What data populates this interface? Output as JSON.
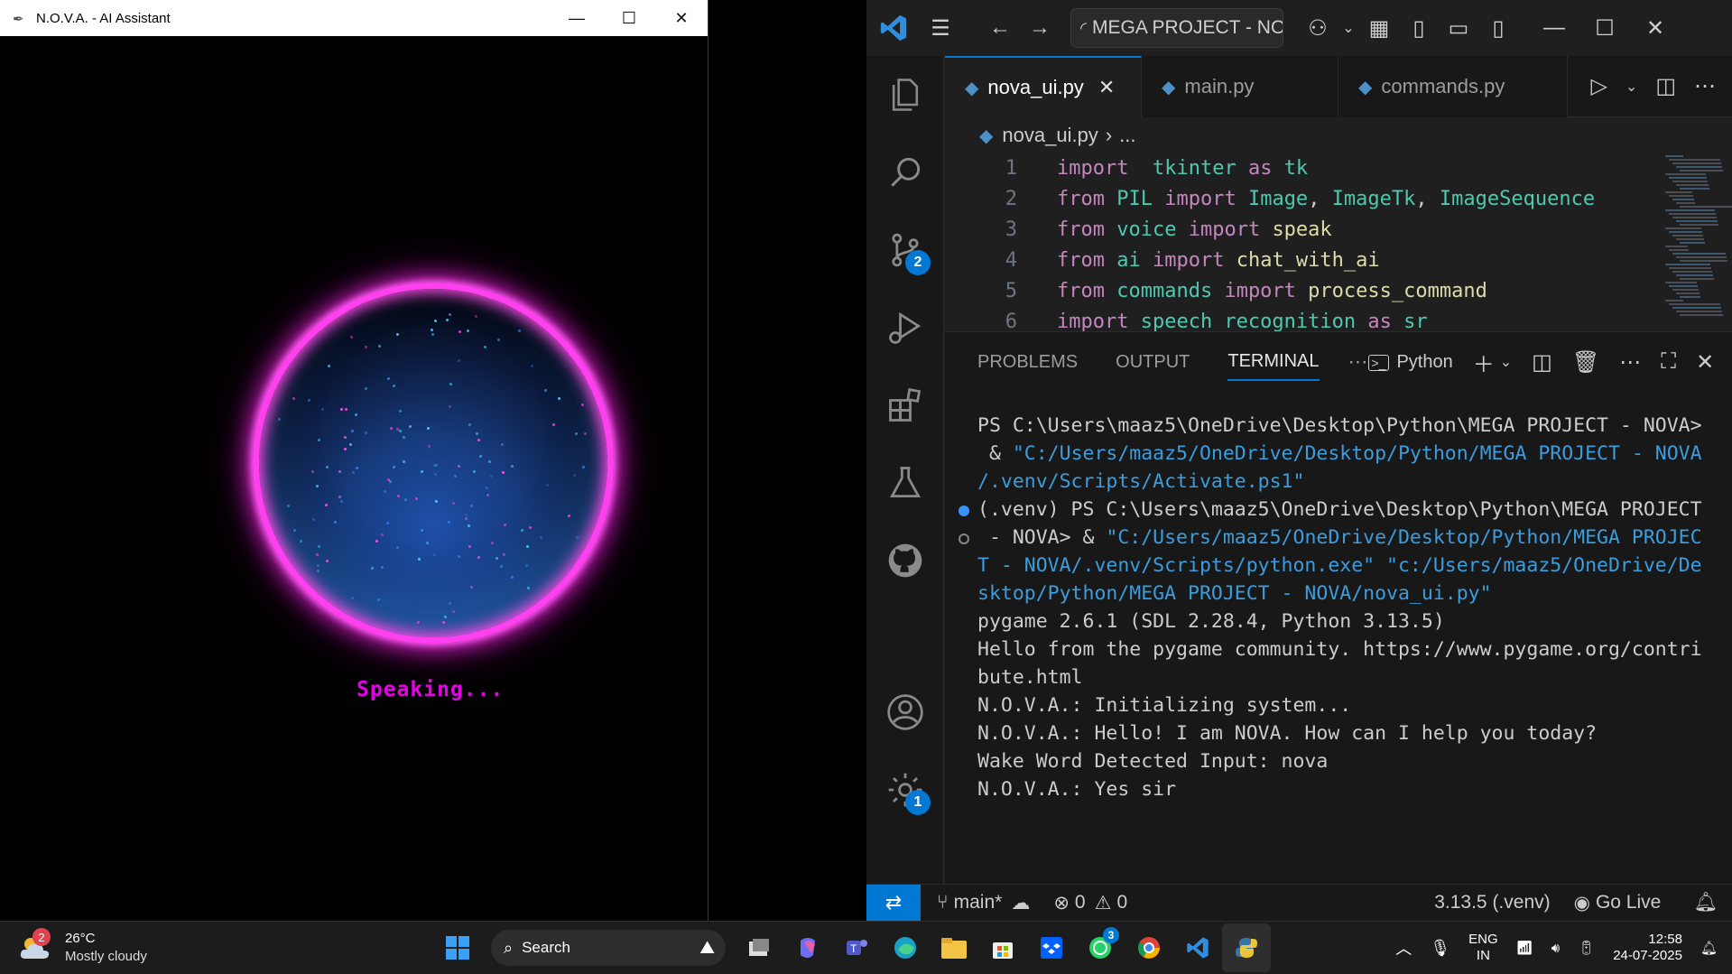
{
  "nova_window": {
    "title": "N.O.V.A. - AI Assistant",
    "status_text": "Speaking...",
    "colors": {
      "ring": "#ff40ef",
      "status": "#e600e6",
      "core": "#1e4fa8"
    }
  },
  "vscode": {
    "command_center": "MEGA PROJECT - NOVA",
    "tabs": [
      {
        "label": "nova_ui.py",
        "active": true
      },
      {
        "label": "main.py",
        "active": false
      },
      {
        "label": "commands.py",
        "active": false
      }
    ],
    "breadcrumb": {
      "file": "nova_ui.py",
      "rest": "..."
    },
    "code_lines": [
      {
        "n": "1",
        "t": [
          [
            "kw",
            "import"
          ],
          [
            "",
            "  "
          ],
          [
            "md",
            "tkinter"
          ],
          [
            "",
            ""
          ],
          [
            "kw",
            " as "
          ],
          [
            "md",
            "tk"
          ]
        ]
      },
      {
        "n": "2",
        "t": [
          [
            "kw",
            "from "
          ],
          [
            "md",
            "PIL"
          ],
          [
            "kw",
            " import "
          ],
          [
            "md",
            "Image"
          ],
          [
            "",
            ", "
          ],
          [
            "md",
            "ImageTk"
          ],
          [
            "",
            ", "
          ],
          [
            "md",
            "ImageSequence"
          ]
        ]
      },
      {
        "n": "3",
        "t": [
          [
            "kw",
            "from "
          ],
          [
            "md",
            "voice"
          ],
          [
            "kw",
            " import "
          ],
          [
            "fn",
            "speak"
          ]
        ]
      },
      {
        "n": "4",
        "t": [
          [
            "kw",
            "from "
          ],
          [
            "md",
            "ai"
          ],
          [
            "kw",
            " import "
          ],
          [
            "fn",
            "chat_with_ai"
          ]
        ]
      },
      {
        "n": "5",
        "t": [
          [
            "kw",
            "from "
          ],
          [
            "md",
            "commands"
          ],
          [
            "kw",
            " import "
          ],
          [
            "fn",
            "process_command"
          ]
        ]
      },
      {
        "n": "6",
        "t": [
          [
            "kw",
            "import "
          ],
          [
            "md",
            "speech_recognition"
          ],
          [
            "kw",
            " as "
          ],
          [
            "md",
            "sr"
          ]
        ]
      }
    ],
    "panel_tabs": [
      "PROBLEMS",
      "OUTPUT",
      "TERMINAL"
    ],
    "terminal_profile": "Python",
    "terminal_lines": [
      {
        "dot": "",
        "parts": [
          [
            "",
            "PS C:\\Users\\maaz5\\OneDrive\\Desktop\\Python\\MEGA PROJECT - NOVA>"
          ]
        ]
      },
      {
        "dot": "",
        "parts": [
          [
            "",
            " & "
          ],
          [
            "str",
            "\"C:/Users/maaz5/OneDrive/Desktop/Python/MEGA PROJECT - NOVA"
          ]
        ]
      },
      {
        "dot": "",
        "parts": [
          [
            "str",
            "/.venv/Scripts/Activate.ps1\""
          ]
        ]
      },
      {
        "dot": "blue",
        "parts": [
          [
            "",
            "(.venv) PS C:\\Users\\maaz5\\OneDrive\\Desktop\\Python\\MEGA PROJECT"
          ]
        ]
      },
      {
        "dot": "hollow",
        "parts": [
          [
            "",
            " - NOVA> & "
          ],
          [
            "str",
            "\"C:/Users/maaz5/OneDrive/Desktop/Python/MEGA PROJEC"
          ]
        ]
      },
      {
        "dot": "",
        "parts": [
          [
            "str",
            "T - NOVA/.venv/Scripts/python.exe\" \"c:/Users/maaz5/OneDrive/De"
          ]
        ]
      },
      {
        "dot": "",
        "parts": [
          [
            "str",
            "sktop/Python/MEGA PROJECT - NOVA/nova_ui.py\""
          ]
        ]
      },
      {
        "dot": "",
        "parts": [
          [
            "",
            "pygame 2.6.1 (SDL 2.28.4, Python 3.13.5)"
          ]
        ]
      },
      {
        "dot": "",
        "parts": [
          [
            "",
            "Hello from the pygame community. https://www.pygame.org/contri"
          ]
        ]
      },
      {
        "dot": "",
        "parts": [
          [
            "",
            "bute.html"
          ]
        ]
      },
      {
        "dot": "",
        "parts": [
          [
            "",
            "N.O.V.A.: Initializing system..."
          ]
        ]
      },
      {
        "dot": "",
        "parts": [
          [
            "",
            "N.O.V.A.: Hello! I am NOVA. How can I help you today?"
          ]
        ]
      },
      {
        "dot": "",
        "parts": [
          [
            "",
            "Wake Word Detected Input: nova"
          ]
        ]
      },
      {
        "dot": "",
        "parts": [
          [
            "",
            "N.O.V.A.: Yes sir"
          ]
        ]
      }
    ],
    "activity_badges": {
      "source_control": "2",
      "settings": "1"
    },
    "status": {
      "branch": "main*",
      "errors": "0",
      "warnings": "0",
      "python_version": "3.13.5 (.venv)",
      "go_live": "Go Live"
    }
  },
  "taskbar": {
    "weather_temp": "26°C",
    "weather_desc": "Mostly cloudy",
    "weather_badge": "2",
    "search_label": "Search",
    "whatsapp_badge": "3",
    "lang_top": "ENG",
    "lang_bottom": "IN",
    "time": "12:58",
    "date": "24-07-2025"
  }
}
